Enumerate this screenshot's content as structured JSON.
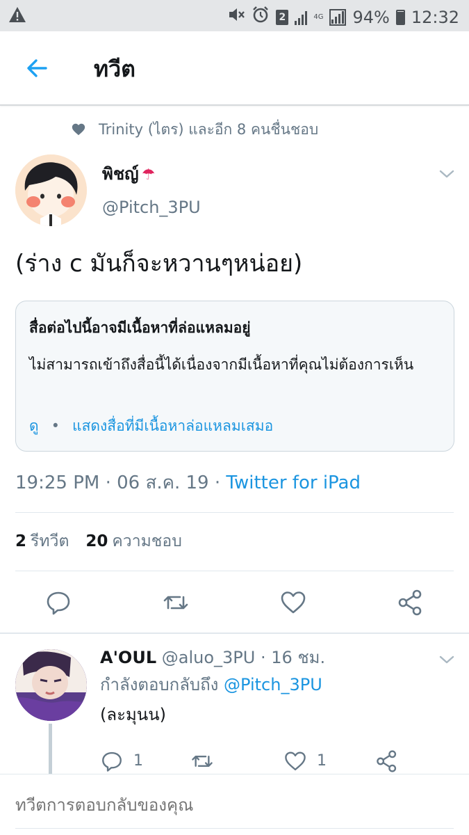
{
  "status_bar": {
    "battery": "94%",
    "time": "12:32",
    "sim_slot": "2",
    "network": "4G",
    "icons": [
      "warning-icon",
      "mute-icon",
      "alarm-icon",
      "sim-icon",
      "signal-icon",
      "battery-icon"
    ]
  },
  "header": {
    "title": "ทวีต",
    "back_icon": "arrow-left-icon"
  },
  "social_context": {
    "text": "Trinity (ไตร) และอีก 8 คนชื่นชอบ",
    "icon": "heart-icon"
  },
  "tweet": {
    "author_name": "พิชญ์",
    "author_emoji": "☂",
    "author_handle": "@Pitch_3PU",
    "text": "(ร่าง c มันก็จะหวานๆหน่อย)",
    "time": "19:25 PM",
    "date": "06 ส.ค. 19",
    "separator": "·",
    "source": "Twitter for iPad",
    "retweets_count": "2",
    "retweets_label": "รีทวีต",
    "likes_count": "20",
    "likes_label": "ความชอบ"
  },
  "sensitive_media": {
    "title": "สื่อต่อไปนี้อาจมีเนื้อหาที่ล่อแหลมอยู่",
    "body": "ไม่สามารถเข้าถึงสื่อนี้ได้เนื่องจากมีเนื้อหาที่คุณไม่ต้องการเห็น",
    "view_label": "ดู",
    "dot": "•",
    "always_show_label": "แสดงสื่อที่มีเนื้อหาล่อแหลมเสมอ"
  },
  "reply": {
    "author_name": "A'OUL",
    "author_handle": "@aluo_3PU",
    "time_ago": "· 16 ชม.",
    "replying_to_label": "กำลังตอบกลับถึง",
    "replying_to_handle": "@Pitch_3PU",
    "text": "(ละมุนน)",
    "reply_count": "1",
    "like_count": "1"
  },
  "compose": {
    "placeholder": "ทวีตการตอบกลับของคุณ"
  },
  "colors": {
    "accent": "#1da1f2",
    "link": "#1b95e0",
    "secondary_text": "#657786",
    "divider": "#e1e8ed",
    "status_bar_bg": "#e4e6e8"
  }
}
